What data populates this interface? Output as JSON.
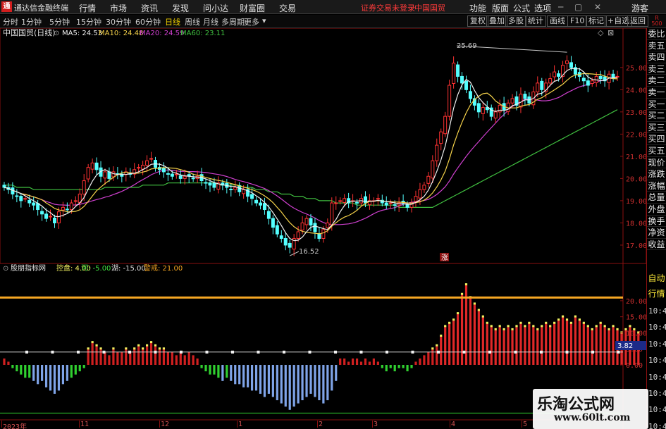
{
  "menubar": {
    "logo_text": "通",
    "items": [
      "通达信金融终端",
      "行情",
      "市场",
      "资讯",
      "发现",
      "问小达",
      "财富圈",
      "交易"
    ],
    "warning": "证券交易未登录",
    "stock_name": "中国国贸",
    "right_items": [
      "功能",
      "版面",
      "公式",
      "选项"
    ],
    "guest": "游客"
  },
  "toolbar": {
    "periods": [
      "分时",
      "1分钟",
      "5分钟",
      "15分钟",
      "30分钟",
      "60分钟",
      "日线",
      "周线",
      "月线",
      "多周期",
      "更多"
    ],
    "active_period": "日线",
    "right_buttons": [
      "复权",
      "叠加",
      "多股",
      "统计",
      "画线",
      "F10",
      "标记",
      "+自选",
      "返回"
    ]
  },
  "main_chart": {
    "title": "中国国贸(日线)",
    "ma_labels": [
      {
        "text": "MA5: 24.53",
        "color": "#f0f0f0"
      },
      {
        "text": "MA10: 24.48",
        "color": "#f5d24a"
      },
      {
        "text": "MA20: 24.59",
        "color": "#d040d0"
      },
      {
        "text": "MA60: 23.11",
        "color": "#40c040"
      }
    ],
    "high_label": "25.69",
    "low_label": "16.52",
    "event_marker": "涨"
  },
  "indicator": {
    "title": "股朋指标网",
    "params": [
      {
        "text": "控盘: 4.00",
        "color": "#f0f060"
      },
      {
        "text": "河: -5.00",
        "color": "#40e040"
      },
      {
        "text": "湖: -15.00",
        "color": "#e0e0e0"
      },
      {
        "text": "警戒: 21.00",
        "color": "#f5a623"
      }
    ],
    "current_value": "3.82"
  },
  "right_panel": {
    "labels": [
      "委比",
      "卖五",
      "卖四",
      "卖三",
      "卖二",
      "卖一",
      "买一",
      "买二",
      "买三",
      "买四",
      "买五",
      "现价",
      "涨跌",
      "涨幅",
      "总量",
      "外盘",
      "换手",
      "净资",
      "收益"
    ],
    "header_line1": "R",
    "header_line2": "500",
    "bottom_labels": [
      "自动",
      "行情"
    ],
    "times": [
      "10:44",
      "10:45",
      "10:45",
      "10:45",
      "10:45",
      "10:45",
      "10:45",
      "10:45"
    ]
  },
  "axes": {
    "price_ticks": [
      "25.00",
      "24.00",
      "23.00",
      "22.00",
      "21.00",
      "20.00",
      "19.00",
      "18.00",
      "17.00"
    ],
    "indicator_ticks": [
      "20.00",
      "15.00",
      "10.00",
      "5.00",
      "0.00"
    ],
    "date_labels": [
      "2023年",
      "11",
      "12",
      "1",
      "2",
      "3",
      "4",
      "5"
    ]
  },
  "watermark": {
    "line1": "乐淘公式网",
    "line2": "www.60lt.com"
  },
  "colors": {
    "up": "#ff3232",
    "down": "#54ffff",
    "ma5": "#f0f0f0",
    "ma10": "#f5d24a",
    "ma20": "#d040d0",
    "ma60": "#40c040",
    "alert_line": "#f5a623"
  },
  "chart_data": {
    "type": "candlestick",
    "ylim": [
      16.3,
      26.2
    ],
    "closes": [
      19.6,
      19.5,
      19.3,
      19.2,
      19.0,
      19.1,
      18.9,
      18.8,
      18.6,
      18.4,
      18.2,
      18.3,
      18.0,
      18.5,
      18.7,
      18.6,
      18.9,
      19.0,
      19.3,
      19.9,
      20.5,
      20.7,
      20.4,
      20.1,
      20.3,
      20.0,
      20.3,
      20.2,
      20.1,
      20.3,
      20.2,
      20.4,
      20.5,
      20.6,
      20.8,
      20.9,
      20.5,
      20.4,
      20.3,
      20.2,
      20.1,
      20.2,
      20.0,
      20.1,
      20.1,
      20.0,
      20.1,
      19.9,
      19.8,
      19.7,
      19.6,
      19.8,
      19.7,
      19.6,
      19.5,
      19.6,
      19.4,
      19.5,
      19.2,
      19.1,
      18.9,
      18.8,
      18.6,
      18.2,
      17.8,
      17.5,
      17.3,
      17.0,
      16.9,
      17.3,
      17.6,
      18.0,
      18.2,
      17.9,
      17.6,
      17.3,
      17.7,
      18.0,
      18.9,
      18.9,
      19.0,
      19.1,
      18.9,
      19.0,
      18.9,
      19.1,
      18.9,
      19.0,
      19.0,
      19.1,
      18.9,
      18.8,
      18.9,
      18.8,
      18.9,
      18.9,
      18.7,
      18.9,
      19.2,
      19.5,
      19.7,
      20.1,
      20.8,
      21.5,
      22.1,
      22.8,
      24.2,
      25.2,
      24.6,
      24.3,
      24.0,
      23.6,
      23.3,
      23.0,
      23.2,
      23.1,
      22.8,
      23.0,
      23.3,
      23.1,
      23.4,
      23.6,
      23.3,
      23.8,
      23.6,
      23.4,
      23.9,
      24.3,
      24.0,
      24.3,
      24.5,
      24.8,
      24.6,
      25.1,
      25.3,
      25.0,
      24.7,
      24.6,
      24.4,
      24.2,
      24.4,
      24.6,
      24.5,
      24.4,
      24.7,
      24.5,
      24.6
    ],
    "ma60": [
      19.7,
      19.7,
      19.7,
      19.6,
      19.6,
      19.6,
      19.6,
      19.5,
      19.5,
      19.5,
      19.5,
      19.5,
      19.5,
      19.5,
      19.5,
      19.5,
      19.5,
      19.5,
      19.5,
      19.5,
      19.5,
      19.5,
      19.5,
      19.5,
      19.6,
      19.6,
      19.6,
      19.6,
      19.6,
      19.6,
      19.6,
      19.6,
      19.6,
      19.7,
      19.7,
      19.7,
      19.7,
      19.7,
      19.7,
      19.8,
      19.8,
      19.8,
      19.8,
      19.8,
      19.8,
      19.8,
      19.8,
      19.8,
      19.8,
      19.8,
      19.8,
      19.7,
      19.7,
      19.7,
      19.7,
      19.7,
      19.7,
      19.6,
      19.6,
      19.6,
      19.5,
      19.5,
      19.5,
      19.4,
      19.4,
      19.4,
      19.3,
      19.3,
      19.3,
      19.2,
      19.2,
      19.2,
      19.1,
      19.1,
      19.1,
      19.0,
      19.0,
      19.0,
      19.0,
      18.9,
      18.9,
      18.9,
      18.9,
      18.9,
      18.8,
      18.8,
      18.8,
      18.8,
      18.8,
      18.8,
      18.8,
      18.8,
      18.8,
      18.8,
      18.7,
      18.7,
      18.7,
      18.7,
      18.7,
      18.7,
      18.7,
      18.7,
      18.7,
      18.8,
      18.9,
      19.0,
      19.1,
      19.2,
      19.3,
      19.4,
      19.5,
      19.6,
      19.7,
      19.8,
      19.9,
      20.0,
      20.1,
      20.2,
      20.3,
      20.4,
      20.5,
      20.6,
      20.7,
      20.8,
      20.9,
      21.0,
      21.1,
      21.2,
      21.3,
      21.4,
      21.5,
      21.6,
      21.7,
      21.8,
      21.9,
      22.0,
      22.1,
      22.2,
      22.3,
      22.4,
      22.5,
      22.6,
      22.7,
      22.8,
      22.9,
      23.0,
      23.1
    ],
    "indicator_values": [
      2,
      1,
      -1,
      -2,
      -3,
      -4,
      -4,
      -5,
      -6,
      -5,
      -7,
      -8,
      -9,
      -8,
      -6,
      -5,
      -4,
      -3,
      -2,
      -1,
      5,
      7,
      6,
      5,
      4,
      3,
      5,
      4,
      4,
      5,
      4,
      5,
      6,
      5,
      6,
      7,
      6,
      5,
      5,
      4,
      4,
      3,
      4,
      3,
      4,
      3,
      2,
      -1,
      -2,
      -3,
      -3,
      -4,
      -5,
      -4,
      -5,
      -6,
      -6,
      -7,
      -7,
      -8,
      -8,
      -9,
      -10,
      -9,
      -10,
      -11,
      -12,
      -13,
      -14,
      -13,
      -12,
      -11,
      -10,
      -9,
      -10,
      -11,
      -12,
      -11,
      -8,
      -5,
      2,
      2,
      1,
      2,
      2,
      1,
      2,
      1,
      2,
      1,
      -1,
      -2,
      -1,
      -2,
      -1,
      -1,
      -2,
      -1,
      1,
      2,
      3,
      4,
      5,
      6,
      9,
      12,
      13,
      14,
      16,
      22,
      25,
      21,
      19,
      17,
      15,
      13,
      12,
      11,
      12,
      11,
      12,
      11,
      12,
      13,
      12,
      13,
      12,
      11,
      12,
      13,
      12,
      13,
      14,
      15,
      14,
      13,
      15,
      14,
      13,
      12,
      11,
      12,
      13,
      12,
      11,
      12,
      11,
      10,
      11,
      12,
      11,
      10
    ],
    "lines": {
      "control": 4.0,
      "river": -5.0,
      "lake": -15.0,
      "alert": 21.0
    },
    "ind_ylim": [
      -18,
      27
    ]
  }
}
